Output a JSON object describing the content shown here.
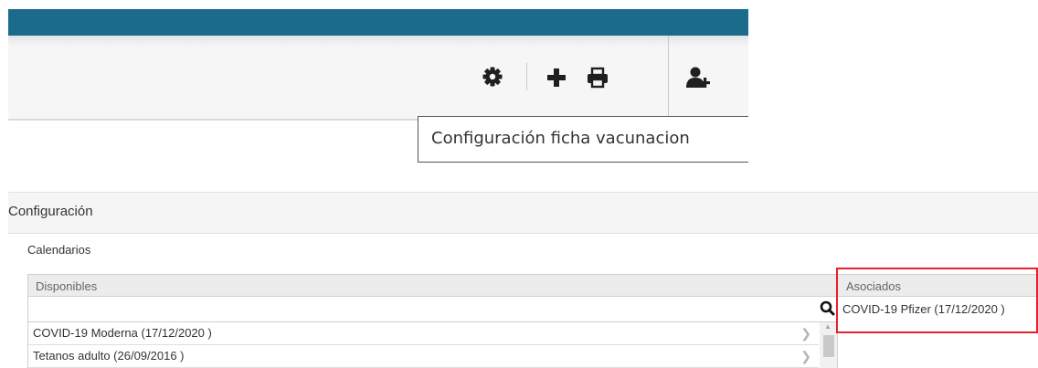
{
  "toolbar": {
    "icons": [
      "gear-icon",
      "plus-icon",
      "print-icon",
      "add-user-icon"
    ],
    "tooltip": "Configuración ficha vacunacion"
  },
  "section": {
    "title": "Configuración"
  },
  "calendarios": {
    "label": "Calendarios",
    "disponibles": {
      "header": "Disponibles",
      "search_value": "",
      "items": [
        {
          "label": "COVID-19 Moderna (17/12/2020 )"
        },
        {
          "label": "Tetanos adulto (26/09/2016 )"
        }
      ]
    },
    "asociados": {
      "header": "Asociados",
      "items": [
        {
          "label": "COVID-19 Pfizer (17/12/2020 )"
        }
      ]
    }
  },
  "colors": {
    "topbar": "#1b6b8d",
    "highlight": "#e8202a",
    "icon": "#1f1f1f"
  }
}
